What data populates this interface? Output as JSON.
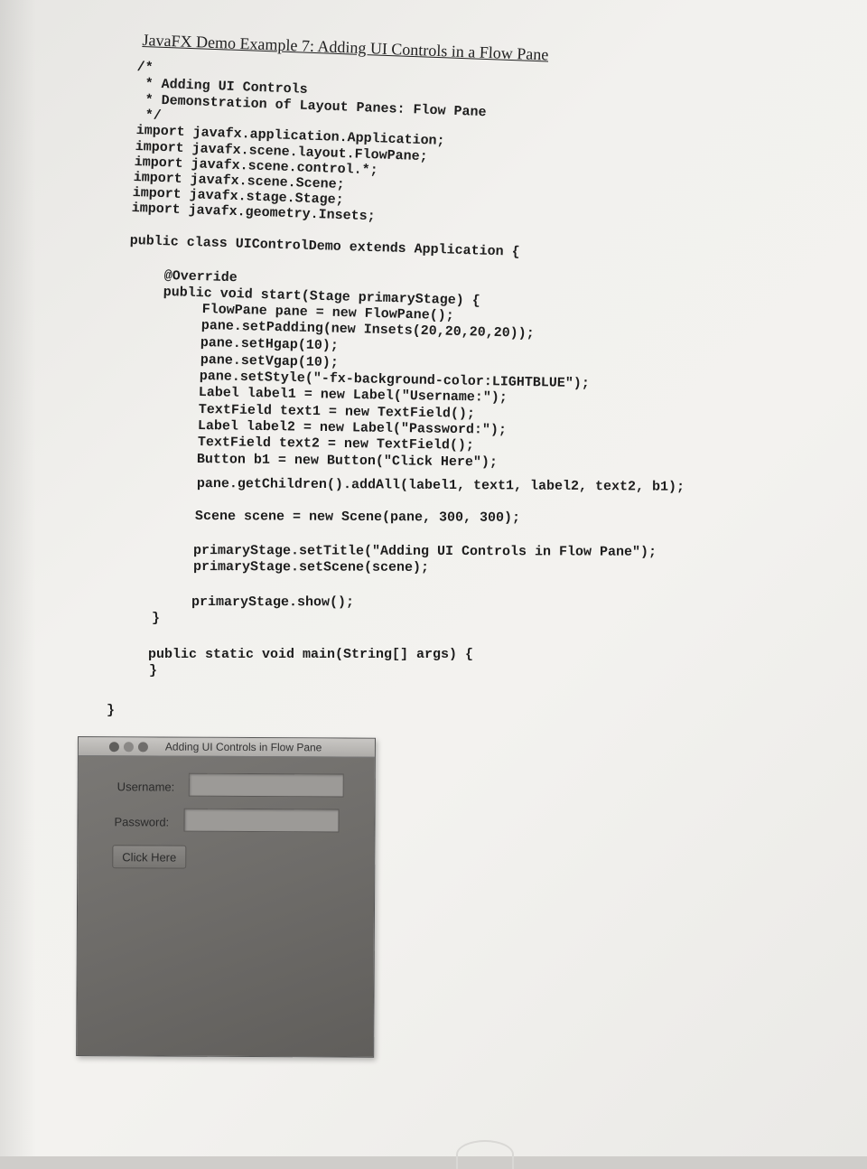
{
  "document": {
    "title": "JavaFX Demo Example 7: Adding UI Controls in a Flow Pane"
  },
  "code_lines": [
    "/*",
    " * Adding UI Controls",
    " * Demonstration of Layout Panes: Flow Pane",
    " */",
    "import javafx.application.Application;",
    "import javafx.scene.layout.FlowPane;",
    "import javafx.scene.control.*;",
    "import javafx.scene.Scene;",
    "import javafx.stage.Stage;",
    "import javafx.geometry.Insets;",
    "public class UIControlDemo extends Application {",
    "@Override",
    "public void start(Stage primaryStage) {",
    "FlowPane pane = new FlowPane();",
    "pane.setPadding(new Insets(20,20,20,20));",
    "pane.setHgap(10);",
    "pane.setVgap(10);",
    "pane.setStyle(\"-fx-background-color:LIGHTBLUE\");",
    "Label label1 = new Label(\"Username:\");",
    "TextField text1 = new TextField();",
    "Label label2 = new Label(\"Password:\");",
    "TextField text2 = new TextField();",
    "Button b1 = new Button(\"Click Here\");",
    "pane.getChildren().addAll(label1, text1, label2, text2, b1);",
    "Scene scene = new Scene(pane, 300, 300);",
    "primaryStage.setTitle(\"Adding UI Controls in Flow Pane\");",
    "primaryStage.setScene(scene);",
    "primaryStage.show();",
    "}",
    "public static void main(String[] args) {",
    "}",
    "}"
  ],
  "window": {
    "title": "Adding UI Controls in Flow Pane",
    "username_label": "Username:",
    "password_label": "Password:",
    "button_label": "Click Here"
  }
}
